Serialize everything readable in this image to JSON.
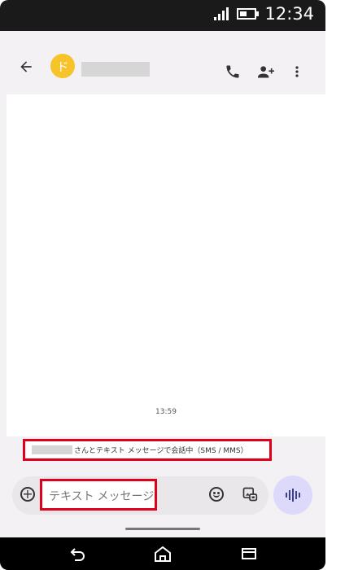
{
  "status_bar": {
    "clock": "12:34"
  },
  "app_bar": {
    "avatar_initial": "ド"
  },
  "messages": {
    "time": "13:59"
  },
  "banner": {
    "text": "さんとテキスト メッセージで会話中（SMS / MMS）"
  },
  "composer": {
    "placeholder": "テキスト メッセージ",
    "value": "テキスト メッセージ"
  },
  "icons": {
    "back": "arrow-left-icon",
    "call": "phone-icon",
    "add_person": "person-add-icon",
    "more": "more-vert-icon",
    "add": "plus-circle-icon",
    "emoji": "emoji-icon",
    "gallery": "gallery-icon",
    "voice": "voice-icon",
    "nav_back": "back-icon",
    "nav_home": "home-icon",
    "nav_recents": "recent-apps-icon"
  },
  "colors": {
    "status_bar": "#1a1a1a",
    "app_bar": "#f3f1f4",
    "chat_bg": "#ffffff",
    "avatar": "#f7c32b",
    "highlight": "#e0001b",
    "composer": "#e9e7ea",
    "voice_button": "#dcd9fb"
  }
}
